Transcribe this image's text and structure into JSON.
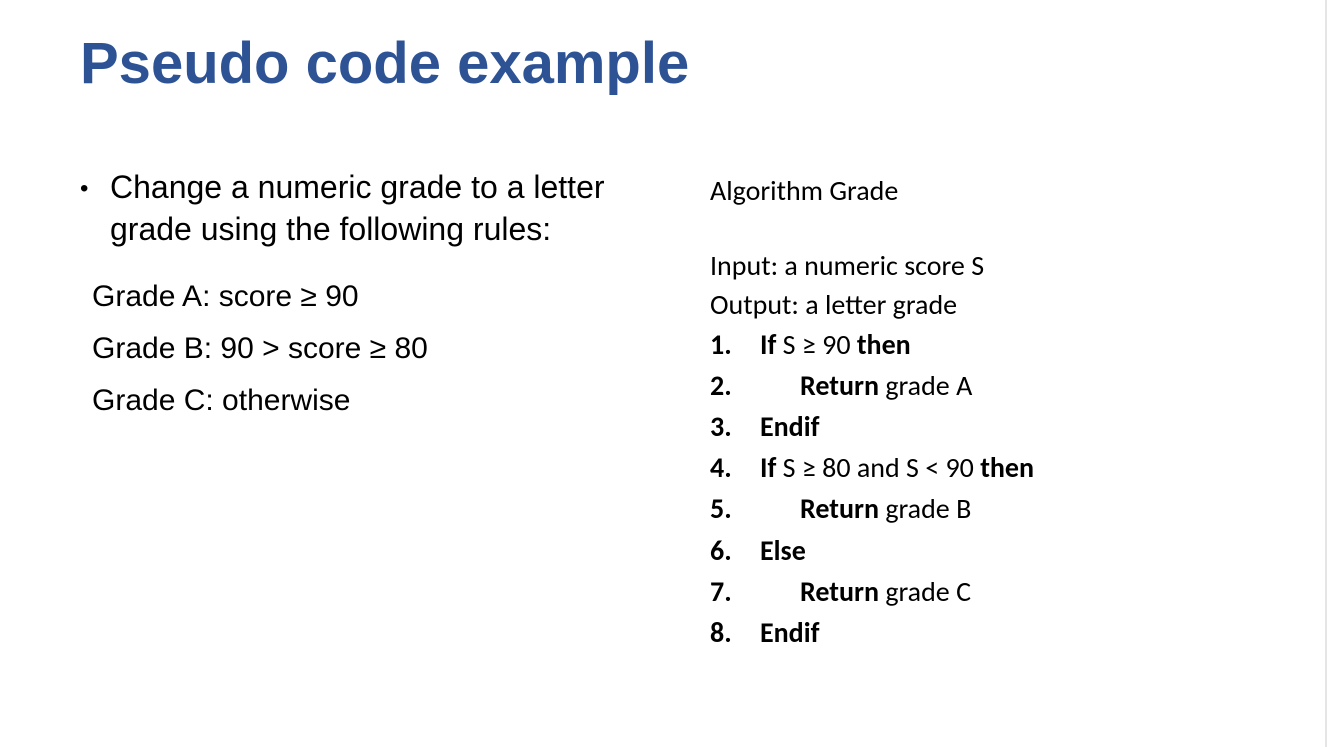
{
  "title": "Pseudo code example",
  "left": {
    "bullet": "Change a numeric grade to a letter grade using the following rules:",
    "rules": [
      "Grade A: score ≥ 90",
      "Grade B:  90 > score ≥ 80",
      "Grade C: otherwise"
    ]
  },
  "right": {
    "algo_title": "Algorithm Grade",
    "input": "Input: a numeric score S",
    "output": "Output: a letter grade",
    "steps": [
      {
        "n": "1.",
        "pre": "If ",
        "mid": "S ≥ 90 ",
        "post": "then",
        "indent": false,
        "bold_pre": true,
        "bold_mid": false,
        "bold_post": true
      },
      {
        "n": "2.",
        "pre": "Return ",
        "mid": "grade A",
        "post": "",
        "indent": true,
        "bold_pre": true,
        "bold_mid": false,
        "bold_post": false
      },
      {
        "n": "3.",
        "pre": "Endif",
        "mid": "",
        "post": "",
        "indent": false,
        "bold_pre": true,
        "bold_mid": false,
        "bold_post": false
      },
      {
        "n": "4.",
        "pre": "If ",
        "mid": "S ≥ 80 and S < 90 ",
        "post": "then",
        "indent": false,
        "bold_pre": true,
        "bold_mid": false,
        "bold_post": true
      },
      {
        "n": "5.",
        "pre": "Return ",
        "mid": "grade B",
        "post": "",
        "indent": true,
        "bold_pre": true,
        "bold_mid": false,
        "bold_post": false
      },
      {
        "n": "6.",
        "pre": "Else",
        "mid": "",
        "post": "",
        "indent": false,
        "bold_pre": true,
        "bold_mid": false,
        "bold_post": false
      },
      {
        "n": "7.",
        "pre": "Return ",
        "mid": "grade C",
        "post": "",
        "indent": true,
        "bold_pre": true,
        "bold_mid": false,
        "bold_post": false
      },
      {
        "n": "8.",
        "pre": "Endif",
        "mid": "",
        "post": "",
        "indent": false,
        "bold_pre": true,
        "bold_mid": false,
        "bold_post": false
      }
    ]
  }
}
